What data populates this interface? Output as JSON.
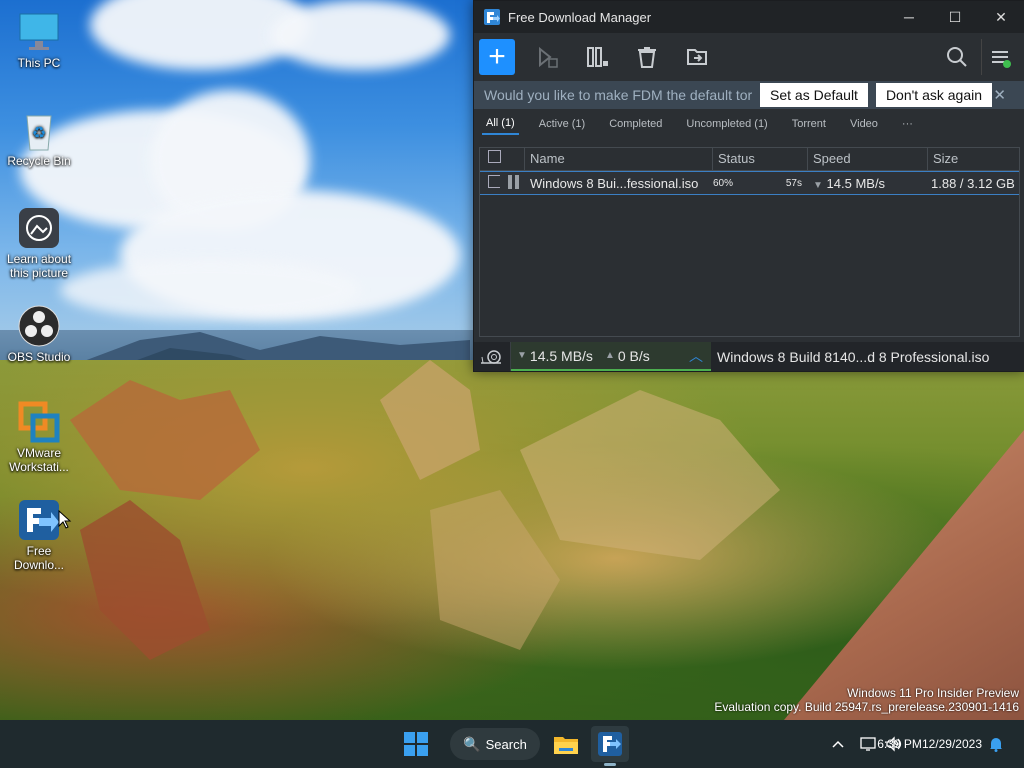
{
  "desktop": {
    "icons": [
      {
        "label": "This PC",
        "icon": "monitor-icon"
      },
      {
        "label": "Recycle Bin",
        "icon": "recycle-bin-icon"
      },
      {
        "label": "Learn about this picture",
        "icon": "camera-icon"
      },
      {
        "label": "OBS Studio",
        "icon": "obs-icon"
      },
      {
        "label": "VMware Workstati...",
        "icon": "vmware-icon"
      },
      {
        "label": "Free Downlo...",
        "icon": "fdm-icon"
      }
    ],
    "watermark_line1": "Windows 11 Pro Insider Preview",
    "watermark_line2": "Evaluation copy. Build 25947.rs_prerelease.230901-1416"
  },
  "fdm": {
    "title": "Free Download Manager",
    "window_controls": {
      "minimize": "─",
      "maximize": "☐",
      "close": "✕"
    },
    "toolbar": {
      "add": "+"
    },
    "notice": {
      "message": "Would you like to make FDM the default tor...",
      "set_default": "Set as Default",
      "dont_ask": "Don't ask again",
      "close": "✕"
    },
    "tabs": [
      "All (1)",
      "Active (1)",
      "Completed",
      "Uncompleted (1)",
      "Torrent",
      "Video",
      "···"
    ],
    "columns": {
      "name": "Name",
      "status": "Status",
      "speed": "Speed",
      "size": "Size"
    },
    "rows": [
      {
        "name": "Windows 8 Bui...fessional.iso",
        "percent": "60%",
        "eta": "57s",
        "speed": "14.5 MB/s",
        "size": "1.88 / 3.12 GB"
      }
    ],
    "statusbar": {
      "download_speed": "14.5 MB/s",
      "upload_speed": "0 B/s",
      "current_file": "Windows 8 Build 8140...d 8 Professional.iso"
    }
  },
  "taskbar": {
    "search_label": "Search",
    "time": "6:39 PM",
    "date": "12/29/2023"
  },
  "colors": {
    "accent": "#1e90ff",
    "window_bg": "#2b2f33",
    "notice_bg": "#3b4753",
    "taskbar_bg": "#1f2a2e"
  }
}
